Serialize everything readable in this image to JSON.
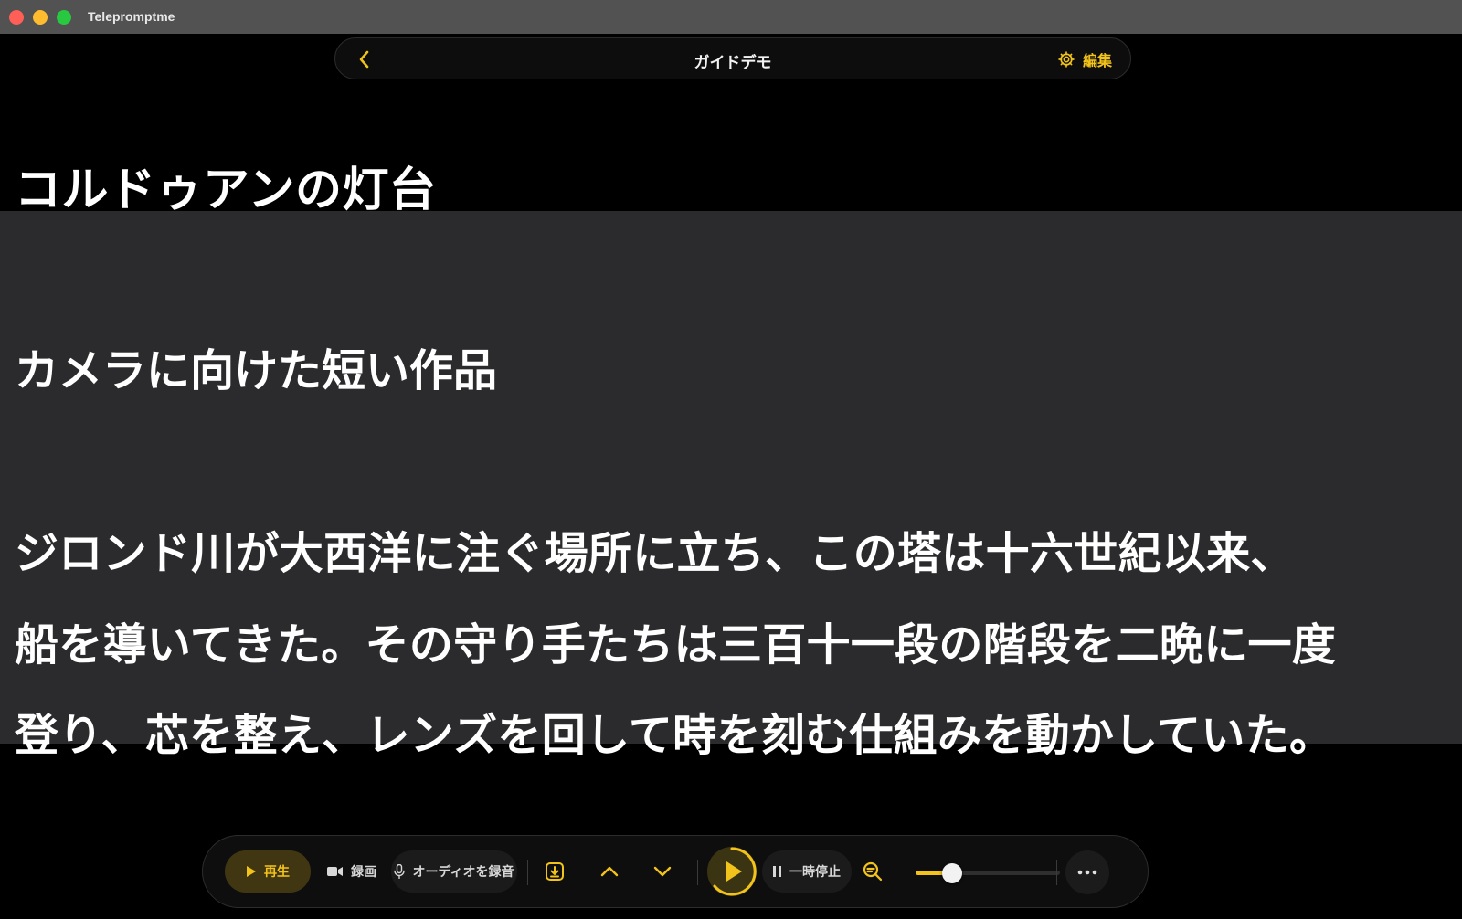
{
  "window": {
    "app_title": "Telepromptme"
  },
  "topbar": {
    "title": "ガイドデモ",
    "edit_label": "編集"
  },
  "script": {
    "title": "コルドゥアンの灯台",
    "subtitle": "カメラに向けた短い作品",
    "lines": [
      "ジロンド川が大西洋に注ぐ場所に立ち、この塔は十六世紀以来、",
      "船を導いてきた。その守り手たちは三百十一段の階段を二晩に一度",
      "登り、芯を整え、レンズを回して時を刻む仕組みを動かしていた。"
    ]
  },
  "controls": {
    "play_label": "再生",
    "record_video_label": "録画",
    "record_audio_label": "オーディオを録音",
    "pause_label": "一時停止",
    "speed_level": 0.25
  },
  "colors": {
    "accent": "#f2c31b",
    "focus_band": "#2b2b2d",
    "background": "#000000"
  },
  "icons": {
    "back": "chevron-left-icon",
    "settings": "gear-icon",
    "play": "play-icon",
    "video": "video-camera-icon",
    "mic": "microphone-icon",
    "download": "download-icon",
    "up": "chevron-up-icon",
    "down": "chevron-down-icon",
    "pause": "pause-icon",
    "zoom": "zoom-out-icon",
    "more": "more-icon"
  }
}
